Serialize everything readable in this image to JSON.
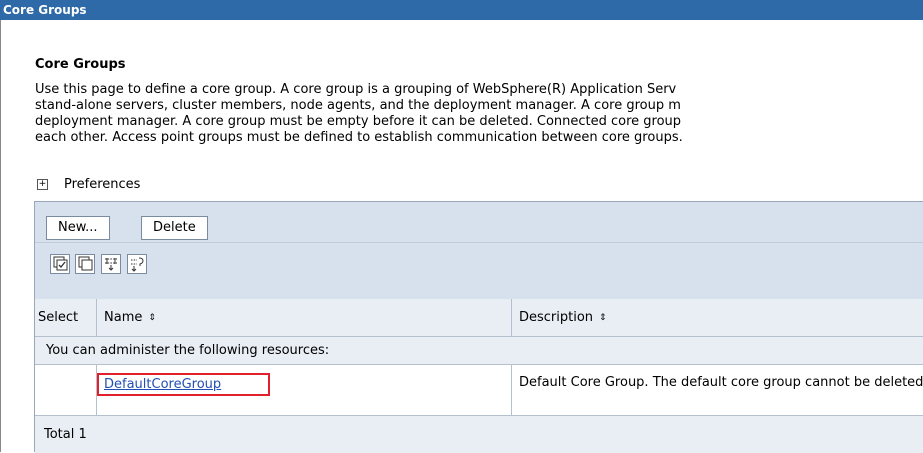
{
  "window": {
    "title": "Core Groups"
  },
  "page": {
    "heading": "Core Groups",
    "description": [
      "Use this page to define a core group. A core group is a grouping of WebSphere(R) Application Serv",
      "stand-alone servers, cluster members, node agents, and the deployment manager. A core group m",
      "deployment manager. A core group must be empty before it can be deleted. Connected core group",
      "each other. Access point groups must be defined to establish communication between core groups."
    ],
    "preferences_label": "Preferences"
  },
  "toolbar": {
    "new_label": "New...",
    "delete_label": "Delete"
  },
  "icons": [
    "select-all-icon",
    "deselect-all-icon",
    "show-filter-icon",
    "clear-filter-icon"
  ],
  "table": {
    "columns": [
      "Select",
      "Name",
      "Description"
    ],
    "sort_glyph": "⇕",
    "section_note": "You can administer the following resources:",
    "rows": [
      {
        "name": "DefaultCoreGroup",
        "description": "Default Core Group. The default core group cannot be deleted."
      }
    ],
    "total": "Total 1"
  },
  "colors": {
    "titlebar": "#2f6aa8",
    "toolbar_bg": "#d7e1ee",
    "row_alt_bg": "#e9eef5",
    "link": "#1f4fb5",
    "highlight_box": "#e0202c"
  }
}
